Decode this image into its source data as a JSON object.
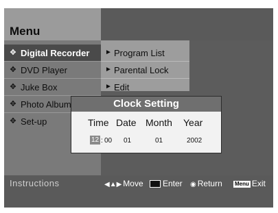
{
  "header": {
    "title": "Menu"
  },
  "main_menu": {
    "items": [
      {
        "label": "Digital Recorder",
        "selected": true
      },
      {
        "label": "DVD Player"
      },
      {
        "label": "Juke Box"
      },
      {
        "label": "Photo Album"
      },
      {
        "label": "Set-up"
      }
    ]
  },
  "sub_menu": {
    "items": [
      {
        "label": "Program List"
      },
      {
        "label": "Parental Lock"
      },
      {
        "label": "Edit"
      }
    ]
  },
  "clock_dialog": {
    "title": "Clock Setting",
    "columns": [
      "Time",
      "Date",
      "Month",
      "Year"
    ],
    "values": {
      "hour": "12",
      "separator": ":",
      "minute": "00",
      "date": "01",
      "month": "01",
      "year": "2002"
    }
  },
  "instructions": {
    "label": "Instructions",
    "hints": [
      {
        "icon": "arrows-icon",
        "text": "Move"
      },
      {
        "icon": "enter-icon",
        "text": "Enter"
      },
      {
        "icon": "return-icon",
        "text": "Return"
      },
      {
        "icon": "menu-icon",
        "key": "Menu",
        "text": "Exit"
      }
    ]
  }
}
